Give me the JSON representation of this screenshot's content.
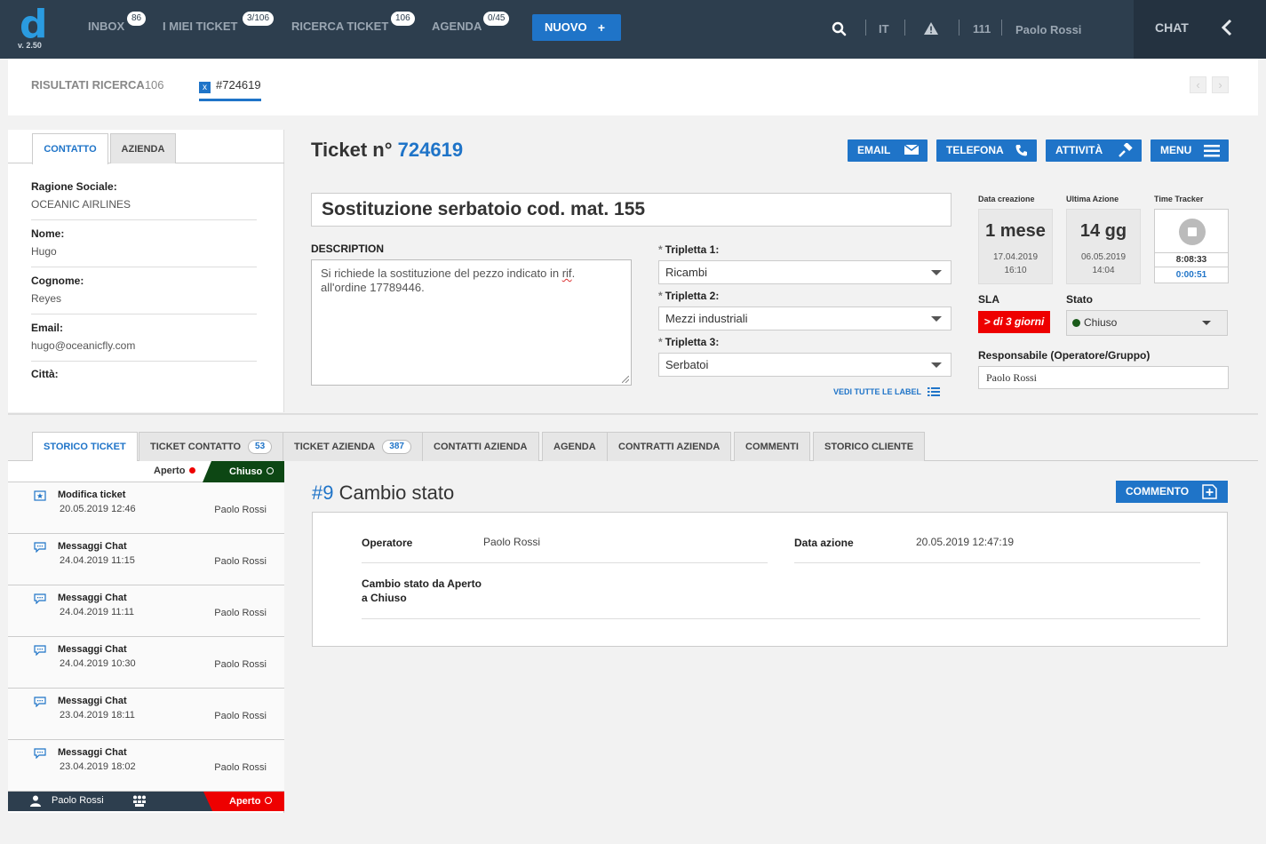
{
  "app": {
    "logo_letter": "d",
    "version": "v. 2.50"
  },
  "nav": [
    {
      "label": "INBOX",
      "badge": "86"
    },
    {
      "label": "I MIEI TICKET",
      "badge": "3/106"
    },
    {
      "label": "RICERCA TICKET",
      "badge": "106"
    },
    {
      "label": "AGENDA",
      "badge": "0/45"
    }
  ],
  "new_button": {
    "label": "NUOVO",
    "plus": "+"
  },
  "topbar": {
    "language": "IT",
    "extension": "111",
    "user": "Paolo Rossi",
    "chat_label": "CHAT"
  },
  "breadcrumb": {
    "results_label": "RISULTATI RICERCA",
    "results_count": "106",
    "close_glyph": "x",
    "ticket_tab": "#724619"
  },
  "contact_panel": {
    "tabs": [
      "CONTATTO",
      "AZIENDA"
    ],
    "fields": [
      {
        "label": "Ragione Sociale:",
        "value": "OCEANIC AIRLINES"
      },
      {
        "label": "Nome:",
        "value": "Hugo"
      },
      {
        "label": "Cognome:",
        "value": "Reyes"
      },
      {
        "label": "Email:",
        "value": "hugo@oceanicfly.com"
      },
      {
        "label": "Città:",
        "value": ""
      }
    ]
  },
  "ticket": {
    "title_prefix": "Ticket n°",
    "number": "724619",
    "actions": [
      "EMAIL",
      "TELEFONA",
      "ATTIVITÀ",
      "MENU"
    ],
    "subject": "Sostituzione serbatoio cod. mat. 155",
    "description_label": "DESCRIPTION",
    "description_before": "Si richiede la sostituzione del pezzo indicato in ",
    "description_flagged": "rif",
    "description_after": ". all'ordine 17789446.",
    "triplets": [
      {
        "label": "Tripletta 1:",
        "value": "Ricambi"
      },
      {
        "label": "Tripletta 2:",
        "value": "Mezzi industriali"
      },
      {
        "label": "Tripletta 3:",
        "value": "Serbatoi"
      }
    ],
    "required_mark": "*",
    "see_all_labels": "VEDI TUTTE LE LABEL"
  },
  "info": {
    "created_label": "Data creazione",
    "created_big": "1 mese",
    "created_date": "17.04.2019",
    "created_time": "16:10",
    "last_action_label": "Ultima Azione",
    "last_action_big": "14 gg",
    "last_action_date": "06.05.2019",
    "last_action_time": "14:04",
    "tracker_label": "Time Tracker",
    "tracker_total": "8:08:33",
    "tracker_current": "0:00:51",
    "sla_label": "SLA",
    "sla_value": "> di 3 giorni",
    "status_label": "Stato",
    "status_value": "Chiuso",
    "owner_label": "Responsabile (Operatore/Gruppo)",
    "owner_value": "Paolo Rossi"
  },
  "bottom_tabs": [
    {
      "label": "STORICO TICKET",
      "count": ""
    },
    {
      "label": "TICKET CONTATTO",
      "count": "53"
    },
    {
      "label": "TICKET AZIENDA",
      "count": "387"
    },
    {
      "label": "CONTATTI AZIENDA",
      "count": ""
    },
    {
      "label": "AGENDA",
      "count": ""
    },
    {
      "label": "CONTRATTI AZIENDA",
      "count": ""
    },
    {
      "label": "COMMENTI",
      "count": ""
    },
    {
      "label": "STORICO CLIENTE",
      "count": ""
    }
  ],
  "history": {
    "header_open": "Aperto",
    "header_closed": "Chiuso",
    "items": [
      {
        "icon": "star-icon",
        "title": "Modifica ticket",
        "date": "20.05.2019 12:46",
        "user": "Paolo Rossi"
      },
      {
        "icon": "chat-icon",
        "title": "Messaggi Chat",
        "date": "24.04.2019 11:15",
        "user": "Paolo Rossi"
      },
      {
        "icon": "chat-icon",
        "title": "Messaggi Chat",
        "date": "24.04.2019 11:11",
        "user": "Paolo Rossi"
      },
      {
        "icon": "chat-icon",
        "title": "Messaggi Chat",
        "date": "24.04.2019 10:30",
        "user": "Paolo Rossi"
      },
      {
        "icon": "chat-icon",
        "title": "Messaggi Chat",
        "date": "23.04.2019 18:11",
        "user": "Paolo Rossi"
      },
      {
        "icon": "chat-icon",
        "title": "Messaggi Chat",
        "date": "23.04.2019 18:02",
        "user": "Paolo Rossi"
      }
    ],
    "footer_user": "Paolo Rossi",
    "footer_status": "Aperto"
  },
  "event": {
    "number": "#9",
    "title": "Cambio stato",
    "comment_button": "COMMENTO",
    "operator_label": "Operatore",
    "operator_value": "Paolo Rossi",
    "date_label": "Data azione",
    "date_value": "20.05.2019 12:47:19",
    "change_line1": "Cambio stato da Aperto",
    "change_line2": "a Chiuso"
  },
  "colors": {
    "primary": "#1f74c8",
    "topbar": "#2d3e4e",
    "sla_red": "#ee0000",
    "closed_green": "#0d4714"
  }
}
